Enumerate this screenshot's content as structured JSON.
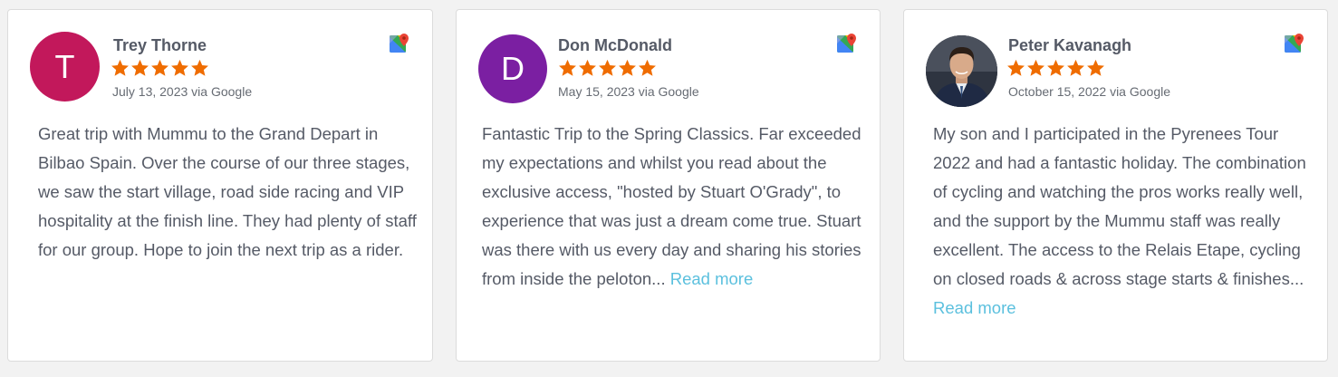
{
  "reviews": [
    {
      "name": "Trey Thorne",
      "initial": "T",
      "avatar_color": "#c2185b",
      "rating": 5,
      "date": "July 13, 2023 via Google",
      "text": "Great trip with Mummu to the Grand Depart in Bilbao Spain. Over the course of our three stages, we saw the start village, road side racing and VIP hospitality at the finish line. They had plenty of staff for our group. Hope to join the next trip as a rider.",
      "read_more": ""
    },
    {
      "name": "Don McDonald",
      "initial": "D",
      "avatar_color": "#7b1fa2",
      "rating": 5,
      "date": "May 15, 2023 via Google",
      "text": "Fantastic Trip to the Spring Classics. Far exceeded my expectations and whilst you read about the exclusive access, \"hosted by Stuart O'Grady\", to experience that was just a dream come true. Stuart was there with us every day and sharing his stories from inside the peloton... ",
      "read_more": "Read more"
    },
    {
      "name": "Peter Kavanagh",
      "initial": "",
      "avatar_color": "#3b4150",
      "rating": 5,
      "date": "October 15, 2022 via Google",
      "text": "My son and I participated in the Pyrenees Tour 2022 and had a fantastic holiday. The combination of cycling and watching the pros works really well, and the support by the Mummu staff was really excellent. The access to the Relais Etape, cycling on closed roads & across stage starts & finishes... ",
      "read_more": "Read more"
    }
  ],
  "colors": {
    "star": "#ef6c00",
    "link": "#5bc0de",
    "text": "#555a66"
  },
  "icons": {
    "source": "google-maps-icon",
    "rating": "star-icon"
  }
}
